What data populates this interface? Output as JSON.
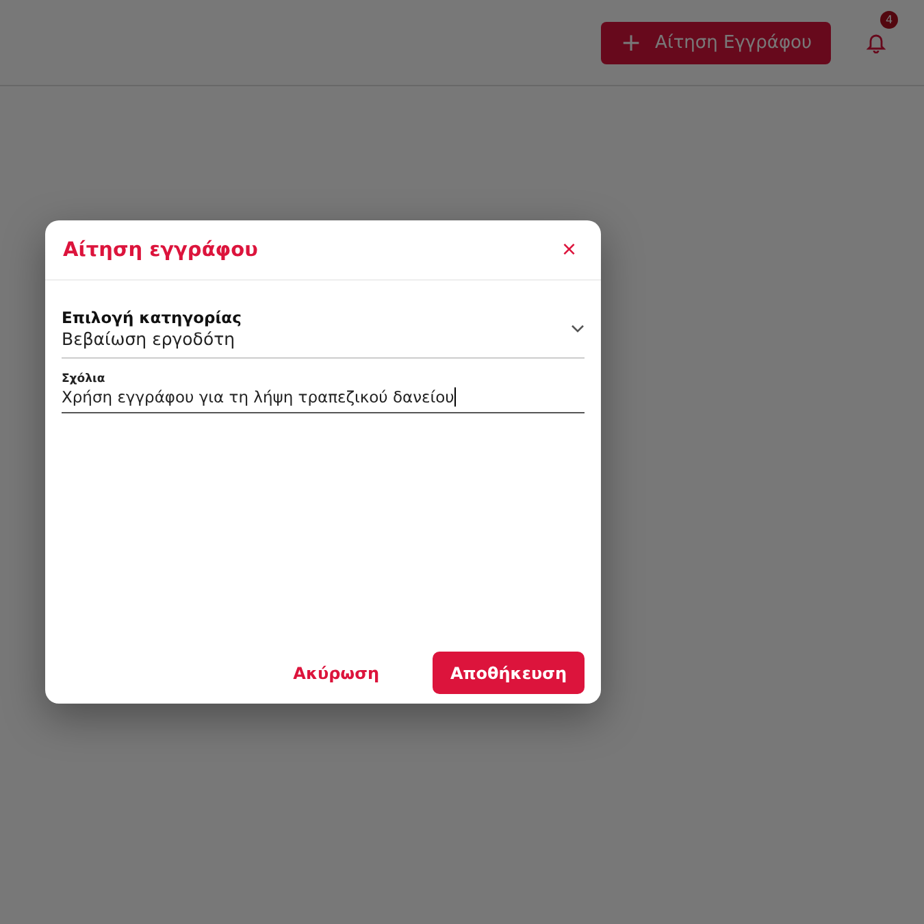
{
  "header": {
    "request_button": {
      "icon": "+",
      "label": "Αίτηση Εγγράφου"
    },
    "notifications": {
      "count": "4"
    }
  },
  "dialog": {
    "title": "Αίτηση εγγράφου",
    "close": "×",
    "category": {
      "label": "Επιλογή κατηγορίας",
      "value": "Βεβαίωση εργοδότη",
      "expanded": false
    },
    "comments": {
      "label": "Σχόλια",
      "value": "Χρήση εγγράφου για τη λήψη τραπεζικού δανείου",
      "focused": true
    },
    "buttons": [
      {
        "label": "Ακύρωση",
        "kind": "text"
      },
      {
        "label": "Αποθήκευση",
        "kind": "primary"
      }
    ]
  }
}
